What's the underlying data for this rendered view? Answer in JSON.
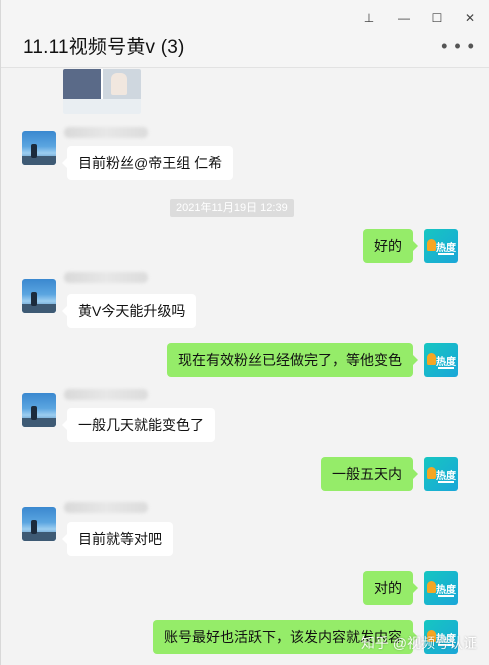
{
  "window": {
    "title": "11.11视频号黄v (3)",
    "controls": {
      "pin": "⊥",
      "minimize": "—",
      "maximize": "☐",
      "close": "✕"
    },
    "more": "• • •"
  },
  "chat": {
    "timestamp": "2021年11月19日 12:39",
    "messages": [
      {
        "side": "in",
        "text": "目前粉丝@帝王组 仁希"
      },
      {
        "side": "out",
        "text": "好的"
      },
      {
        "side": "in",
        "text": "黄V今天能升级吗"
      },
      {
        "side": "out",
        "text": "现在有效粉丝已经做完了，等他变色"
      },
      {
        "side": "in",
        "text": "一般几天就能变色了"
      },
      {
        "side": "out",
        "text": "一般五天内"
      },
      {
        "side": "in",
        "text": "目前就等对吧"
      },
      {
        "side": "out",
        "text": "对的"
      },
      {
        "side": "out",
        "text": "账号最好也活跃下，该发内容就发内容"
      }
    ],
    "self_avatar_label": "热度"
  },
  "watermark": "知乎 @视频号认证",
  "colors": {
    "outgoing_bubble": "#95ec69",
    "incoming_bubble": "#ffffff",
    "background": "#f3f3f3"
  }
}
